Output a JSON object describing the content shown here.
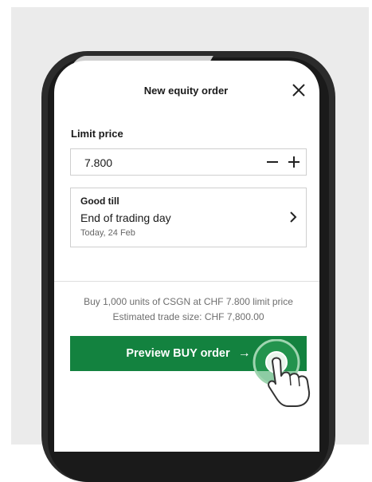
{
  "order": {
    "title": "New equity order",
    "limit_price_label": "Limit price",
    "limit_price_value": "7.800",
    "good_till_label": "Good till",
    "good_till_value": "End of trading day",
    "good_till_date": "Today, 24 Feb",
    "summary_line1": "Buy 1,000 units of CSGN at CHF 7.800 limit price",
    "summary_line2": "Estimated trade size: CHF 7,800.00",
    "preview_button": "Preview BUY order",
    "preview_arrow": "→"
  },
  "icons": {
    "close": "close-icon",
    "minus": "minus-icon",
    "plus": "plus-icon",
    "chevron": "chevron-right-icon",
    "hand": "tap-hand-icon"
  },
  "colors": {
    "accent": "#13823f",
    "tap_ring": "#2fa35a"
  }
}
